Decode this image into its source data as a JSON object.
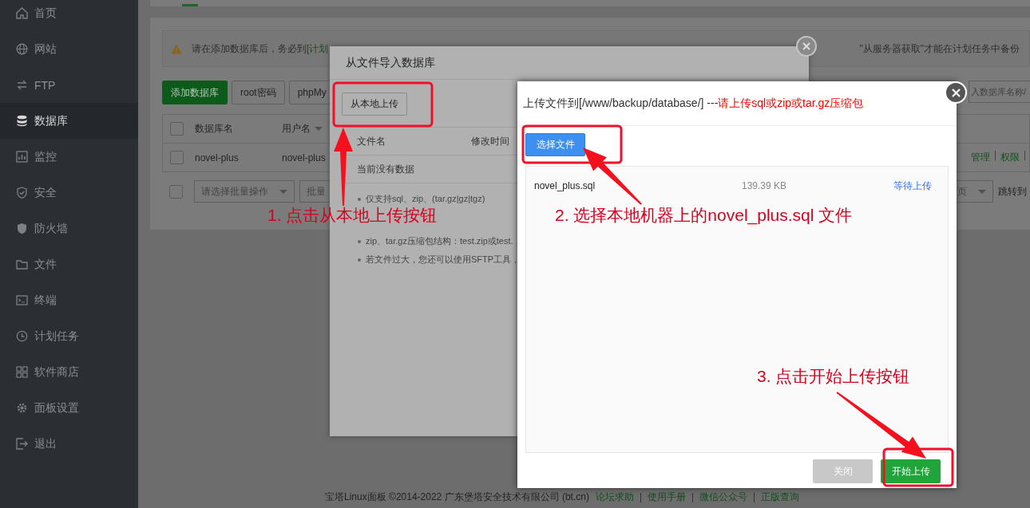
{
  "sidebar": {
    "items": [
      {
        "label": "首页",
        "selected": false
      },
      {
        "label": "网站",
        "selected": false
      },
      {
        "label": "FTP",
        "selected": false
      },
      {
        "label": "数据库",
        "selected": true
      },
      {
        "label": "监控",
        "selected": false
      },
      {
        "label": "安全",
        "selected": false
      },
      {
        "label": "防火墙",
        "selected": false
      },
      {
        "label": "文件",
        "selected": false
      },
      {
        "label": "终端",
        "selected": false
      },
      {
        "label": "计划任务",
        "selected": false
      },
      {
        "label": "软件商店",
        "selected": false
      },
      {
        "label": "面板设置",
        "selected": false
      },
      {
        "label": "退出",
        "selected": false
      }
    ]
  },
  "notice": {
    "text_start": "请在添加数据库后，务必到",
    "link": "[计划",
    "text_end": "\"从服务器获取\"才能在计划任务中备份"
  },
  "toolbar": {
    "buttons": [
      {
        "label": "添加数据库",
        "kind": "primary"
      },
      {
        "label": "root密码",
        "kind": "default"
      },
      {
        "label": "phpMy",
        "kind": "default"
      }
    ]
  },
  "search": {
    "placeholder": "入数据库名称/"
  },
  "db_table": {
    "select_all": {
      "checked": false
    },
    "columns": [
      {
        "label": "数据库名",
        "sortable": false
      },
      {
        "label": "用户名",
        "sortable": true
      }
    ],
    "rows": [
      {
        "checked": false,
        "cells": [
          "novel-plus",
          "novel-plus"
        ],
        "actions": [
          "管理",
          "权限"
        ]
      }
    ]
  },
  "batch": {
    "checked": false,
    "select_placeholder": "请选择批量操作",
    "button": "批量"
  },
  "pagination": {
    "page_select": "页",
    "jump_label": "跳转到"
  },
  "import_dialog": {
    "title": "从文件导入数据库",
    "upload_button": "从本地上传",
    "file_table": {
      "columns": [
        "文件名",
        "修改时间"
      ],
      "empty": "当前没有数据"
    },
    "notes": [
      "仅支持sql、zip、(tar.gz|gz|tgz)",
      "zip、tar.gz压缩包结构：test.zip或test.",
      "若文件过大，您还可以使用SFTP工具，"
    ]
  },
  "upload_dialog": {
    "title": "上传文件到[/www/backup/database/] --- ",
    "hint": "请上传sql或zip或tar.gz压缩包",
    "choose_button": "选择文件",
    "files": [
      {
        "name": "novel_plus.sql",
        "size": "139.39 KB",
        "status": "等待上传"
      }
    ],
    "buttons": [
      {
        "label": "关闭",
        "kind": "secondary"
      },
      {
        "label": "开始上传",
        "kind": "primary"
      }
    ]
  },
  "footer": {
    "copyright": "宝塔Linux面板 ©2014-2022 广东堡塔安全技术有限公司 (bt.cn)",
    "links": [
      "论坛求助",
      "使用手册",
      "微信公众号",
      "正版查询"
    ]
  },
  "annotations": [
    {
      "text": "1. 点击从本地上传按钮"
    },
    {
      "text": "2. 选择本地机器上的novel_plus.sql 文件"
    },
    {
      "text": "3. 点击开始上传按钮"
    }
  ]
}
